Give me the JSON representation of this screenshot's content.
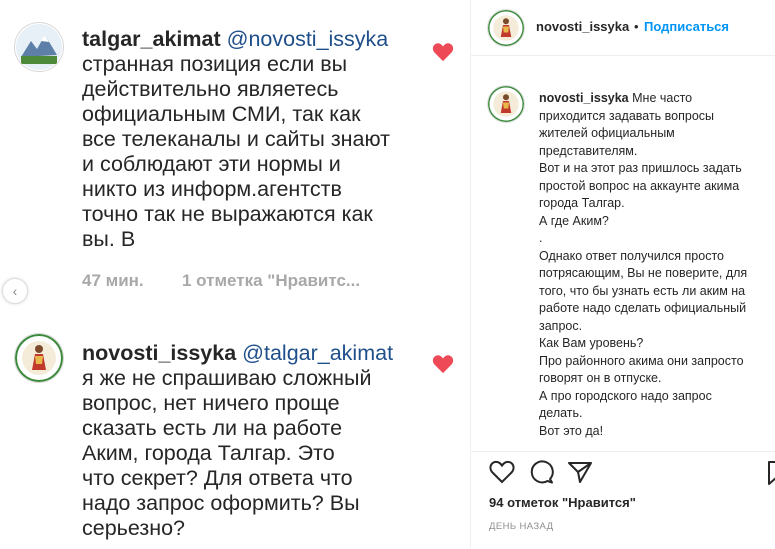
{
  "comments": [
    {
      "username": "talgar_akimat",
      "mention": "@novosti_issyka",
      "lines": [
        "странная позиция если вы",
        "действительно являетесь",
        "официальным СМИ, так как",
        "все телеканалы и сайты знают",
        "и соблюдают эти нормы и",
        "никто из информ.агентств",
        "точно так не выражаются как",
        "вы. В"
      ],
      "time": "47 мин.",
      "likes": "1 отметка \"Нравитс..."
    },
    {
      "username": "novosti_issyka",
      "mention": "@talgar_akimat",
      "lines": [
        "я же не спрашиваю сложный",
        "вопрос, нет ничего проще",
        "сказать есть ли на работе",
        "Аким, города Талгар. Это",
        "что секрет? Для ответа что",
        "надо запрос оформить? Вы",
        "серьезно?"
      ]
    }
  ],
  "post": {
    "username": "novosti_issyka",
    "separator": "•",
    "follow_label": "Подписаться",
    "caption_first": "Мне часто",
    "caption_lines": [
      "приходится задавать вопросы",
      "жителей официальным",
      "представителям.",
      "Вот и на этот раз пришлось задать",
      "простой вопрос на аккаунте акима",
      "города Талгар.",
      "А где Аким?",
      ".",
      "Однако ответ получился просто",
      "потрясающим, Вы не поверите, для",
      "того, что бы узнать есть ли аким на",
      "работе надо сделать официальный",
      "запрос.",
      "Как Вам уровень?",
      "Про районного акима они запросто",
      "говорят он в отпуске.",
      "А про городского надо запрос",
      "делать.",
      "Вот это да!"
    ],
    "likes_text": "94 отметок \"Нравится\"",
    "time_ago": "ДЕНЬ НАЗАД"
  },
  "icons": {
    "heart": "heart-icon",
    "comment": "comment-icon",
    "share": "share-icon",
    "bookmark": "bookmark-icon",
    "prev": "chevron-left-icon"
  },
  "colors": {
    "heart": "#ed4956",
    "link": "#0095f6",
    "mention": "#1f4f8a",
    "muted": "#a8a8a8"
  }
}
